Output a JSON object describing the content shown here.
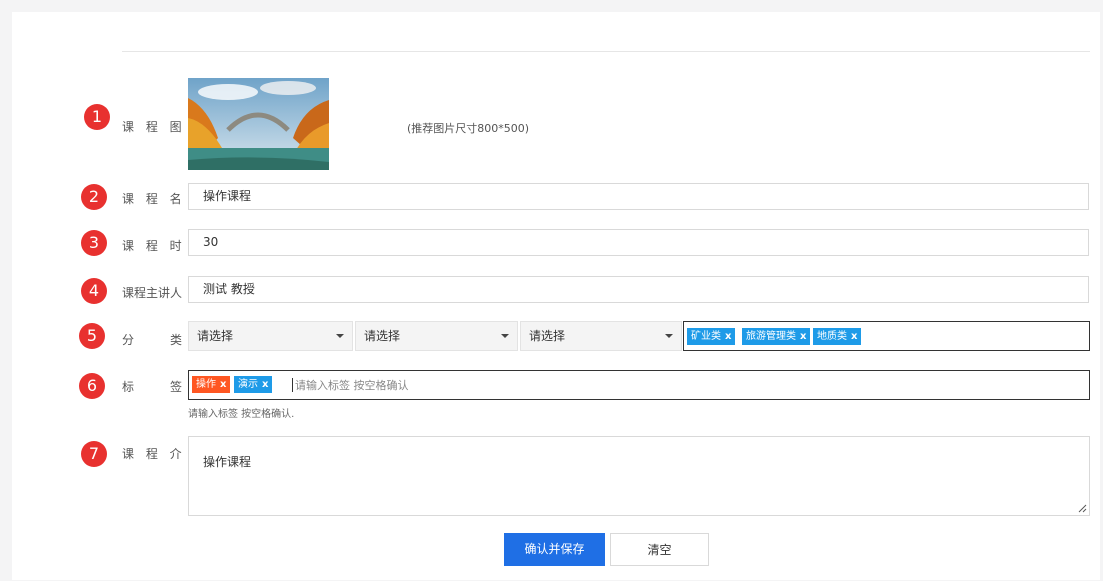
{
  "steps": [
    "1",
    "2",
    "3",
    "4",
    "5",
    "6",
    "7"
  ],
  "image_field": {
    "label": "课 程 图 片",
    "hint": "(推荐图片尺寸800*500)"
  },
  "name_field": {
    "label": "课 程 名 称",
    "value": "操作课程"
  },
  "duration_field": {
    "label": "课 程 时 长",
    "value": "30"
  },
  "lecturer_field": {
    "label": "课程主讲人",
    "value": "测试 教授"
  },
  "category_field": {
    "label_left": "分",
    "label_right": "类",
    "selects": [
      "请选择",
      "请选择",
      "请选择"
    ],
    "tags": [
      "矿业类",
      "旅游管理类",
      "地质类"
    ]
  },
  "tag_field": {
    "label_left": "标",
    "label_right": "签",
    "tags": [
      "操作",
      "演示"
    ],
    "placeholder": "请输入标签 按空格确认",
    "help": "请输入标签 按空格确认."
  },
  "intro_field": {
    "label": "课 程 介 绍",
    "value": "操作课程"
  },
  "actions": {
    "save": "确认并保存",
    "clear": "清空"
  },
  "colors": {
    "badge": "#e8312f",
    "primary": "#1f6fe5",
    "tag_blue": "#1e9be8",
    "tag_orange": "#ff5722"
  }
}
